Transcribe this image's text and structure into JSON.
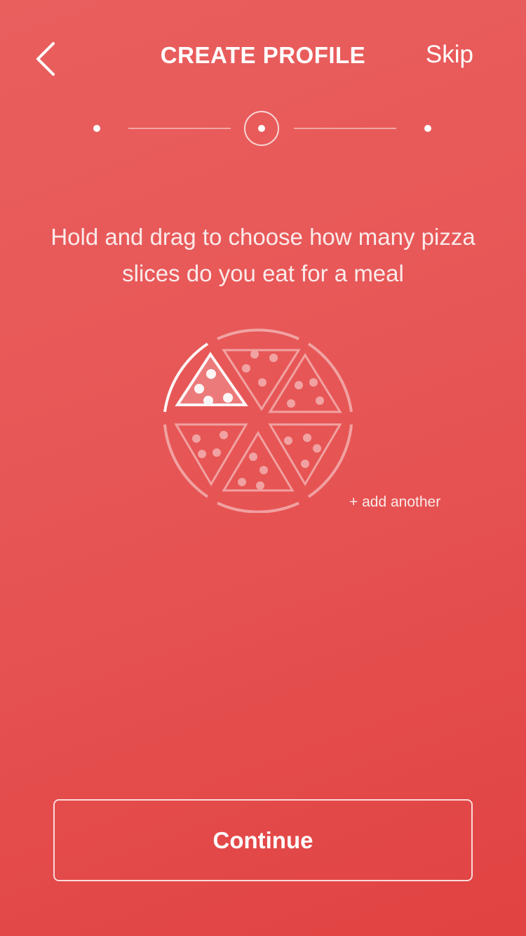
{
  "header": {
    "title": "CREATE PROFILE",
    "skip_label": "Skip",
    "back_icon": "chevron-left-icon"
  },
  "stepper": {
    "total_steps": 3,
    "current_step": 2
  },
  "instruction": {
    "text": "Hold and drag to choose how many pizza slices do you eat for a meal"
  },
  "pizza": {
    "total_slices": 6,
    "selected_slices": 1
  },
  "add_another_label": "+ add another",
  "continue_label": "Continue",
  "colors": {
    "background_top": "#e95f5e",
    "background_bottom": "#e14242",
    "foreground": "#ffffff"
  }
}
